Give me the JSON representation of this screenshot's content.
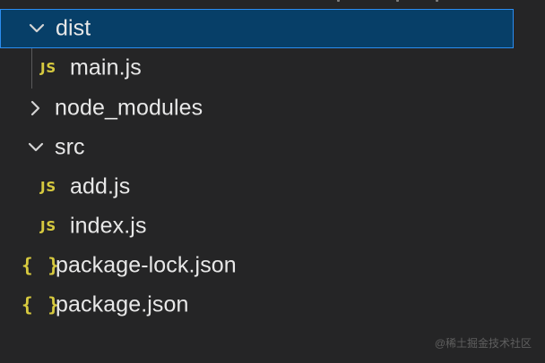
{
  "explorer": {
    "items": [
      {
        "label": "dist",
        "icon": "chevron-down-icon",
        "selected": true
      },
      {
        "label": "main.js",
        "icon": "js-icon",
        "icon_text": "JS"
      },
      {
        "label": "node_modules",
        "icon": "chevron-right-icon"
      },
      {
        "label": "src",
        "icon": "chevron-down-icon"
      },
      {
        "label": "add.js",
        "icon": "js-icon",
        "icon_text": "JS"
      },
      {
        "label": "index.js",
        "icon": "js-icon",
        "icon_text": "JS"
      },
      {
        "label": "package-lock.json",
        "icon": "json-icon",
        "icon_text": "{ }"
      },
      {
        "label": "package.json",
        "icon": "json-icon",
        "icon_text": "{ }"
      }
    ]
  },
  "watermark": "@稀土掘金技术社区",
  "colors": {
    "background": "#252526",
    "selection": "#073f68",
    "selection_border": "#2b8df0",
    "text": "#e8e8e8",
    "icon_yellow": "#d7ca3f"
  }
}
